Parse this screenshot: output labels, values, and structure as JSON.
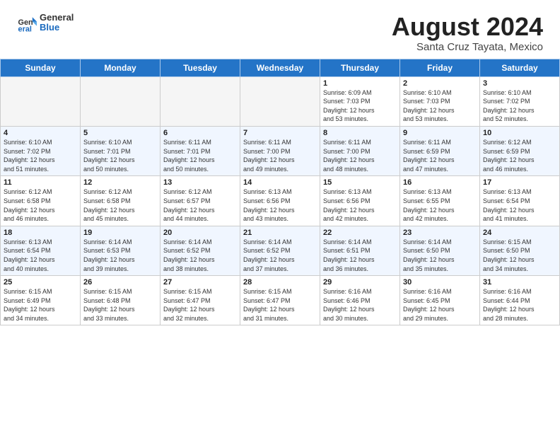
{
  "header": {
    "logo_general": "General",
    "logo_blue": "Blue",
    "month_year": "August 2024",
    "location": "Santa Cruz Tayata, Mexico"
  },
  "weekdays": [
    "Sunday",
    "Monday",
    "Tuesday",
    "Wednesday",
    "Thursday",
    "Friday",
    "Saturday"
  ],
  "weeks": [
    [
      {
        "day": "",
        "info": ""
      },
      {
        "day": "",
        "info": ""
      },
      {
        "day": "",
        "info": ""
      },
      {
        "day": "",
        "info": ""
      },
      {
        "day": "1",
        "info": "Sunrise: 6:09 AM\nSunset: 7:03 PM\nDaylight: 12 hours\nand 53 minutes."
      },
      {
        "day": "2",
        "info": "Sunrise: 6:10 AM\nSunset: 7:03 PM\nDaylight: 12 hours\nand 53 minutes."
      },
      {
        "day": "3",
        "info": "Sunrise: 6:10 AM\nSunset: 7:02 PM\nDaylight: 12 hours\nand 52 minutes."
      }
    ],
    [
      {
        "day": "4",
        "info": "Sunrise: 6:10 AM\nSunset: 7:02 PM\nDaylight: 12 hours\nand 51 minutes."
      },
      {
        "day": "5",
        "info": "Sunrise: 6:10 AM\nSunset: 7:01 PM\nDaylight: 12 hours\nand 50 minutes."
      },
      {
        "day": "6",
        "info": "Sunrise: 6:11 AM\nSunset: 7:01 PM\nDaylight: 12 hours\nand 50 minutes."
      },
      {
        "day": "7",
        "info": "Sunrise: 6:11 AM\nSunset: 7:00 PM\nDaylight: 12 hours\nand 49 minutes."
      },
      {
        "day": "8",
        "info": "Sunrise: 6:11 AM\nSunset: 7:00 PM\nDaylight: 12 hours\nand 48 minutes."
      },
      {
        "day": "9",
        "info": "Sunrise: 6:11 AM\nSunset: 6:59 PM\nDaylight: 12 hours\nand 47 minutes."
      },
      {
        "day": "10",
        "info": "Sunrise: 6:12 AM\nSunset: 6:59 PM\nDaylight: 12 hours\nand 46 minutes."
      }
    ],
    [
      {
        "day": "11",
        "info": "Sunrise: 6:12 AM\nSunset: 6:58 PM\nDaylight: 12 hours\nand 46 minutes."
      },
      {
        "day": "12",
        "info": "Sunrise: 6:12 AM\nSunset: 6:58 PM\nDaylight: 12 hours\nand 45 minutes."
      },
      {
        "day": "13",
        "info": "Sunrise: 6:12 AM\nSunset: 6:57 PM\nDaylight: 12 hours\nand 44 minutes."
      },
      {
        "day": "14",
        "info": "Sunrise: 6:13 AM\nSunset: 6:56 PM\nDaylight: 12 hours\nand 43 minutes."
      },
      {
        "day": "15",
        "info": "Sunrise: 6:13 AM\nSunset: 6:56 PM\nDaylight: 12 hours\nand 42 minutes."
      },
      {
        "day": "16",
        "info": "Sunrise: 6:13 AM\nSunset: 6:55 PM\nDaylight: 12 hours\nand 42 minutes."
      },
      {
        "day": "17",
        "info": "Sunrise: 6:13 AM\nSunset: 6:54 PM\nDaylight: 12 hours\nand 41 minutes."
      }
    ],
    [
      {
        "day": "18",
        "info": "Sunrise: 6:13 AM\nSunset: 6:54 PM\nDaylight: 12 hours\nand 40 minutes."
      },
      {
        "day": "19",
        "info": "Sunrise: 6:14 AM\nSunset: 6:53 PM\nDaylight: 12 hours\nand 39 minutes."
      },
      {
        "day": "20",
        "info": "Sunrise: 6:14 AM\nSunset: 6:52 PM\nDaylight: 12 hours\nand 38 minutes."
      },
      {
        "day": "21",
        "info": "Sunrise: 6:14 AM\nSunset: 6:52 PM\nDaylight: 12 hours\nand 37 minutes."
      },
      {
        "day": "22",
        "info": "Sunrise: 6:14 AM\nSunset: 6:51 PM\nDaylight: 12 hours\nand 36 minutes."
      },
      {
        "day": "23",
        "info": "Sunrise: 6:14 AM\nSunset: 6:50 PM\nDaylight: 12 hours\nand 35 minutes."
      },
      {
        "day": "24",
        "info": "Sunrise: 6:15 AM\nSunset: 6:50 PM\nDaylight: 12 hours\nand 34 minutes."
      }
    ],
    [
      {
        "day": "25",
        "info": "Sunrise: 6:15 AM\nSunset: 6:49 PM\nDaylight: 12 hours\nand 34 minutes."
      },
      {
        "day": "26",
        "info": "Sunrise: 6:15 AM\nSunset: 6:48 PM\nDaylight: 12 hours\nand 33 minutes."
      },
      {
        "day": "27",
        "info": "Sunrise: 6:15 AM\nSunset: 6:47 PM\nDaylight: 12 hours\nand 32 minutes."
      },
      {
        "day": "28",
        "info": "Sunrise: 6:15 AM\nSunset: 6:47 PM\nDaylight: 12 hours\nand 31 minutes."
      },
      {
        "day": "29",
        "info": "Sunrise: 6:16 AM\nSunset: 6:46 PM\nDaylight: 12 hours\nand 30 minutes."
      },
      {
        "day": "30",
        "info": "Sunrise: 6:16 AM\nSunset: 6:45 PM\nDaylight: 12 hours\nand 29 minutes."
      },
      {
        "day": "31",
        "info": "Sunrise: 6:16 AM\nSunset: 6:44 PM\nDaylight: 12 hours\nand 28 minutes."
      }
    ]
  ]
}
